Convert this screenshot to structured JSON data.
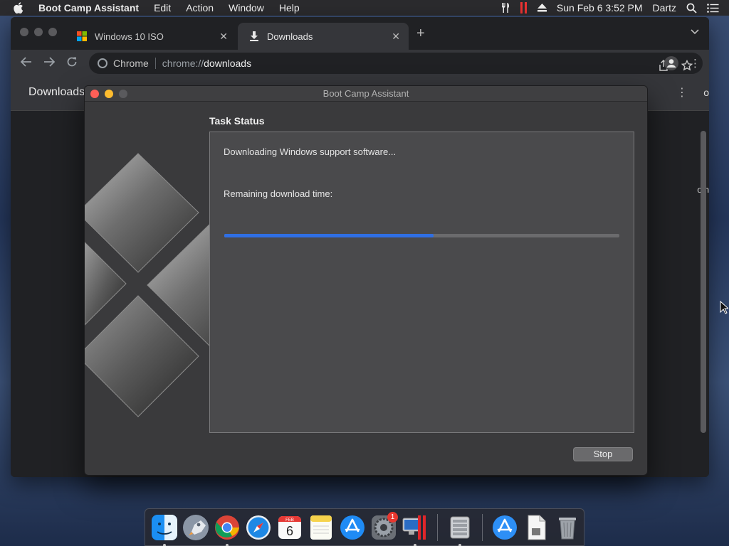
{
  "menubar": {
    "app_name": "Boot Camp Assistant",
    "menus": [
      "Edit",
      "Action",
      "Window",
      "Help"
    ],
    "datetime": "Sun Feb 6  3:52 PM",
    "user": "Dartz"
  },
  "chrome": {
    "tabs": [
      {
        "label": "Windows 10 ISO",
        "active": false
      },
      {
        "label": "Downloads",
        "active": true
      }
    ],
    "site_label": "Chrome",
    "url_scheme": "chrome://",
    "url_host": "downloads",
    "page_title": "Downloads",
    "edge_text_1": "o",
    "edge_text_2": "om"
  },
  "bootcamp": {
    "window_title": "Boot Camp Assistant",
    "task_title": "Task Status",
    "status_message": "Downloading Windows support software...",
    "remaining_label": "Remaining download time:",
    "progress": 0.53,
    "stop_label": "Stop",
    "accent_color": "#2f6fe4"
  },
  "dock": {
    "items": [
      {
        "name": "finder-icon",
        "running": true
      },
      {
        "name": "launchpad-icon",
        "running": false
      },
      {
        "name": "chrome-icon",
        "running": true
      },
      {
        "name": "safari-icon",
        "running": false
      },
      {
        "name": "calendar-icon",
        "running": false,
        "month": "FEB",
        "day": "6"
      },
      {
        "name": "notes-icon",
        "running": false
      },
      {
        "name": "app-store-icon",
        "running": false
      },
      {
        "name": "system-preferences-icon",
        "running": false,
        "badge": "1"
      },
      {
        "name": "parallels-icon",
        "running": true
      },
      {
        "name": "boot-camp-icon",
        "running": true
      },
      {
        "name": "app-store-folder-icon",
        "running": false
      },
      {
        "name": "document-icon",
        "running": false
      },
      {
        "name": "trash-icon",
        "running": false
      }
    ]
  }
}
